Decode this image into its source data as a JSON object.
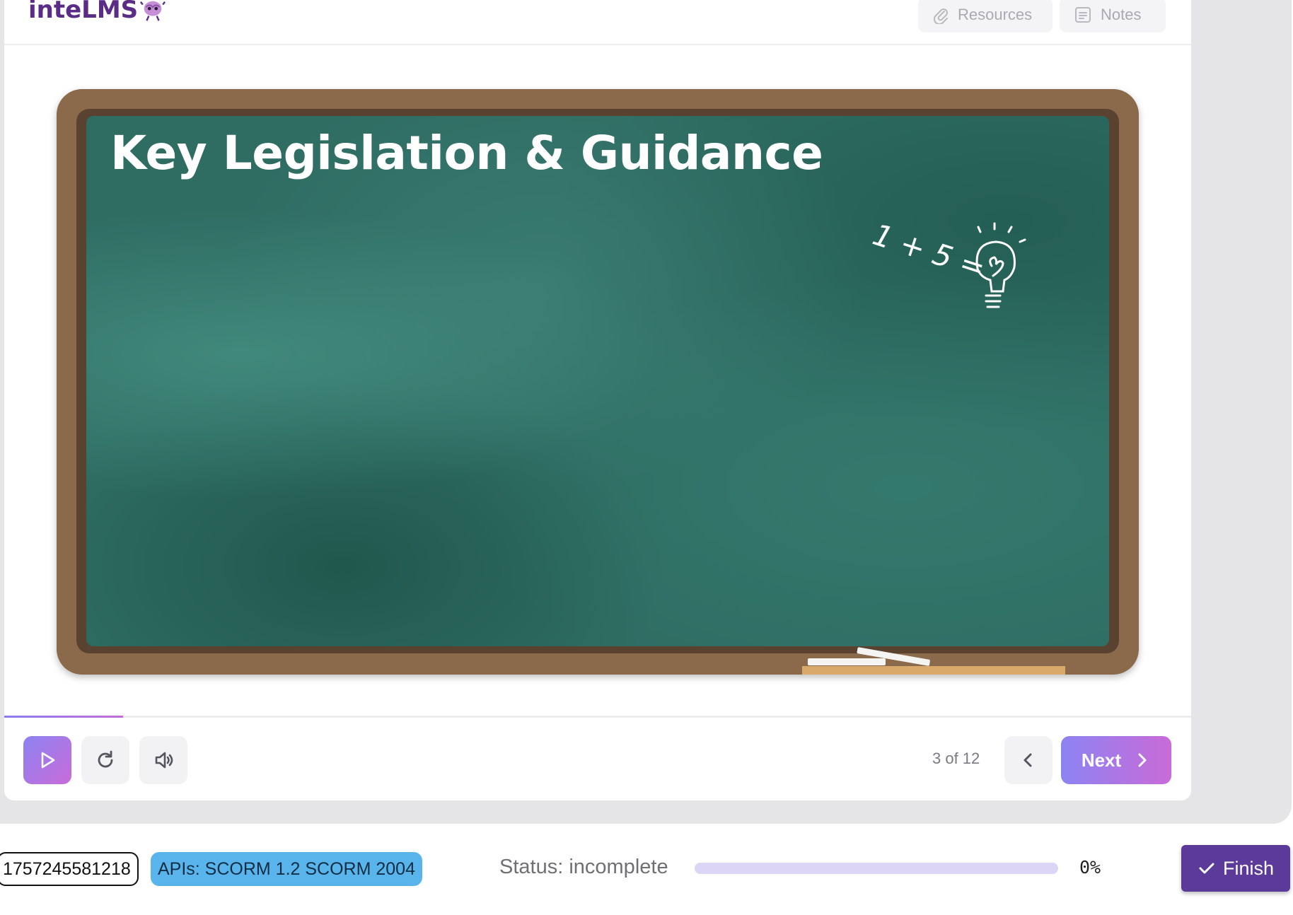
{
  "header": {
    "logo_text": "inteLMS",
    "resources_label": "Resources",
    "notes_label": "Notes"
  },
  "slide": {
    "title": "Key Legislation & Guidance",
    "doodle_text": "1 + 5 ="
  },
  "player": {
    "progress_fraction": 0.1,
    "slide_counter": "3 of 12",
    "next_label": "Next"
  },
  "status_bar": {
    "session_id": "1757245581218",
    "api_badge": "APIs: SCORM 1.2 SCORM 2004",
    "status_text": "Status: incomplete",
    "percent_text": "0%",
    "percent_value": 0,
    "finish_label": "Finish"
  },
  "colors": {
    "brand_purple": "#5b2c86",
    "gradient_start": "#8d83f2",
    "gradient_end": "#c96bd8",
    "chalkboard_green": "#2f6d63",
    "frame_brown": "#8b6a4b",
    "api_blue": "#5ab4ec",
    "finish_purple": "#5b3a9a"
  },
  "icons": {
    "resources": "paperclip-icon",
    "notes": "document-icon",
    "play": "play-icon",
    "replay": "replay-icon",
    "audio": "speaker-icon",
    "prev": "chevron-left-icon",
    "next": "chevron-right-icon",
    "finish": "checkmark-icon"
  }
}
